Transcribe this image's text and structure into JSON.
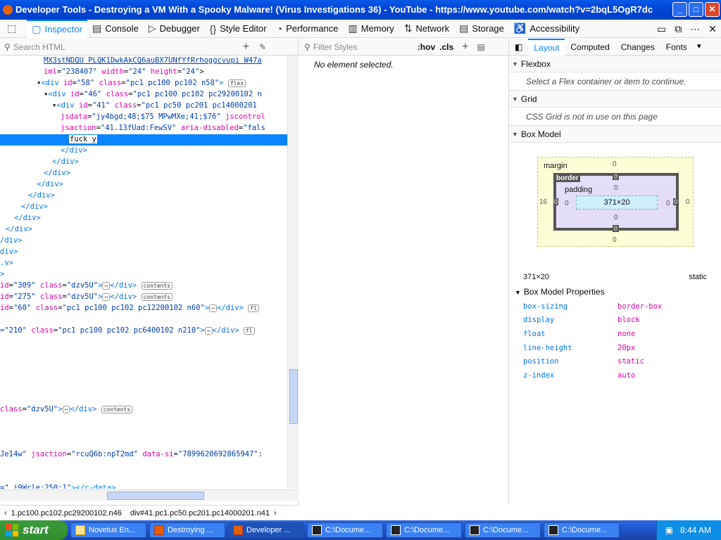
{
  "window": {
    "title": "Developer Tools - Destroying a VM With a Spooky Malware! (Virus Investigations 36) - YouTube - https://www.youtube.com/watch?v=2bqL5OgR7dc",
    "min": "_",
    "max": "□",
    "close": "✕"
  },
  "toolbar": {
    "tools": [
      {
        "label": "Inspector",
        "icon": "▢"
      },
      {
        "label": "Console",
        "icon": "▤"
      },
      {
        "label": "Debugger",
        "icon": "▷"
      },
      {
        "label": "Style Editor",
        "icon": "{}"
      },
      {
        "label": "Performance",
        "icon": "◔"
      },
      {
        "label": "Memory",
        "icon": "▥"
      },
      {
        "label": "Network",
        "icon": "⇅"
      },
      {
        "label": "Storage",
        "icon": "▤"
      },
      {
        "label": "Accessibility",
        "icon": "♿"
      }
    ],
    "pick_icon": "⬚"
  },
  "markup": {
    "search_placeholder": "Search HTML",
    "breadcrumbs": [
      "1.pc100.pc102.pc29200102.n46",
      "div#41.pc1.pc50.pc201.pc14000201.n41"
    ]
  },
  "rules": {
    "filter_placeholder": "Filter Styles",
    "hov": ":hov",
    "cls": ".cls",
    "empty": "No element selected."
  },
  "layout": {
    "tabs": [
      "Layout",
      "Computed",
      "Changes",
      "Fonts"
    ],
    "flexbox": {
      "title": "Flexbox",
      "msg": "Select a Flex container or item to continue."
    },
    "grid": {
      "title": "Grid",
      "msg": "CSS Grid is not in use on this page"
    },
    "boxmodel": {
      "title": "Box Model",
      "margin": "margin",
      "border": "border",
      "padding": "padding",
      "content": "371×20",
      "m_top": "0",
      "m_right": "0",
      "m_bottom": "0",
      "m_left": "16",
      "b_top": "0",
      "b_right": "0",
      "b_bottom": "0",
      "b_left": "0",
      "p_top": "0",
      "p_right": "0",
      "p_bottom": "0",
      "p_left": "0",
      "size": "371×20",
      "position": "static"
    },
    "bmp_title": "Box Model Properties",
    "props": [
      {
        "name": "box-sizing",
        "value": "border-box"
      },
      {
        "name": "display",
        "value": "block"
      },
      {
        "name": "float",
        "value": "none"
      },
      {
        "name": "line-height",
        "value": "20px"
      },
      {
        "name": "position",
        "value": "static"
      },
      {
        "name": "z-index",
        "value": "auto"
      }
    ]
  },
  "taskbar": {
    "start": "start",
    "items": [
      "Novetus En...",
      "Destroying ...",
      "Developer ...",
      "C:\\Docume...",
      "C:\\Docume...",
      "C:\\Docume...",
      "C:\\Docume..."
    ],
    "clock": "8:44 AM"
  }
}
